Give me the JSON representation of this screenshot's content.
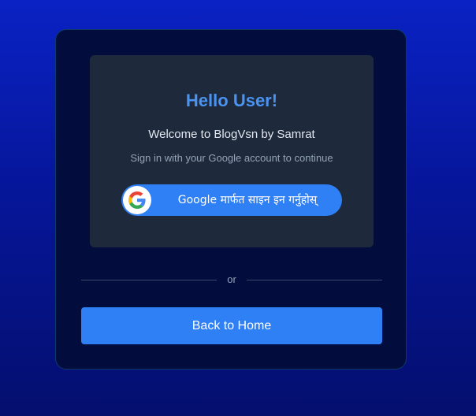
{
  "login_card": {
    "title": "Hello User!",
    "welcome": "Welcome to BlogVsn by Samrat",
    "subtitle": "Sign in with your Google account to continue",
    "google_button_label": "Google मार्फत साइन इन गर्नुहोस्",
    "divider_text": "or",
    "back_button_label": "Back to Home"
  },
  "colors": {
    "accent": "#2f7ff5",
    "title": "#4a93f0",
    "card_bg": "#020c3d",
    "inner_bg": "#1e293b"
  },
  "icons": {
    "google": "google-logo-icon"
  }
}
